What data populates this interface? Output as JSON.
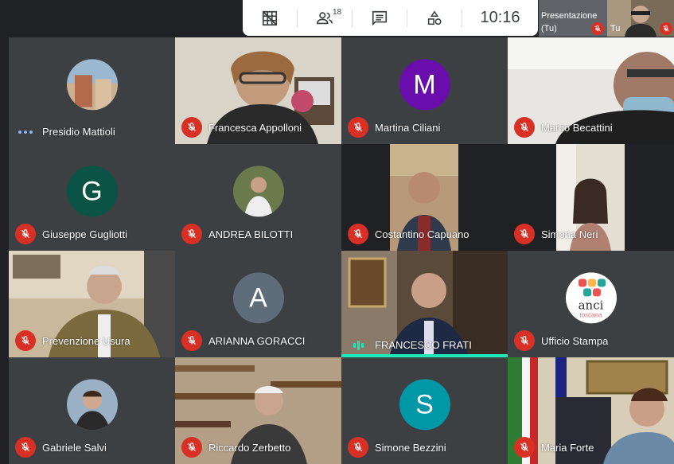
{
  "toolbar": {
    "grid_icon": "grid-off-icon",
    "people_icon": "people-icon",
    "participant_count": "18",
    "chat_icon": "chat-icon",
    "activities_icon": "activities-icon",
    "clock": "10:16"
  },
  "presentation": {
    "label_line1": "Presentazione",
    "label_line2": "(Tu)"
  },
  "self_view": {
    "label": "Tu"
  },
  "participants": [
    {
      "name": "Presidio Mattioli",
      "status": "dots",
      "avatar": "photo"
    },
    {
      "name": "Francesca Appolloni",
      "status": "muted",
      "avatar": "video"
    },
    {
      "name": "Martina Ciliani",
      "status": "muted",
      "avatar": "M",
      "avatar_color": "#6a0dad"
    },
    {
      "name": "Marco Becattini",
      "status": "muted",
      "avatar": "video"
    },
    {
      "name": "Giuseppe Gugliotti",
      "status": "muted",
      "avatar": "G",
      "avatar_color": "#0b5345"
    },
    {
      "name": "ANDREA BILOTTI",
      "status": "muted",
      "avatar": "photo"
    },
    {
      "name": "Costantino Capuano",
      "status": "muted",
      "avatar": "video"
    },
    {
      "name": "Simona Neri",
      "status": "muted",
      "avatar": "video"
    },
    {
      "name": "Prevenzione Usura",
      "status": "muted",
      "avatar": "video"
    },
    {
      "name": "ARIANNA GORACCI",
      "status": "muted",
      "avatar": "A",
      "avatar_color": "#5f6d7a"
    },
    {
      "name": "FRANCESCO FRATI",
      "status": "speaking",
      "avatar": "video"
    },
    {
      "name": "Ufficio Stampa",
      "status": "muted",
      "avatar": "logo"
    },
    {
      "name": "Gabriele Salvi",
      "status": "muted",
      "avatar": "photo"
    },
    {
      "name": "Riccardo Zerbetto",
      "status": "muted",
      "avatar": "video"
    },
    {
      "name": "Simone Bezzini",
      "status": "muted",
      "avatar": "S",
      "avatar_color": "#0097a7"
    },
    {
      "name": "Maria Forte",
      "status": "muted",
      "avatar": "video"
    }
  ],
  "logo": {
    "text": "anci",
    "subtext": "toscana"
  },
  "colors": {
    "muted": "#d93025",
    "speaking": "#1de9b6",
    "tile": "#3c4043",
    "background": "#202124"
  }
}
